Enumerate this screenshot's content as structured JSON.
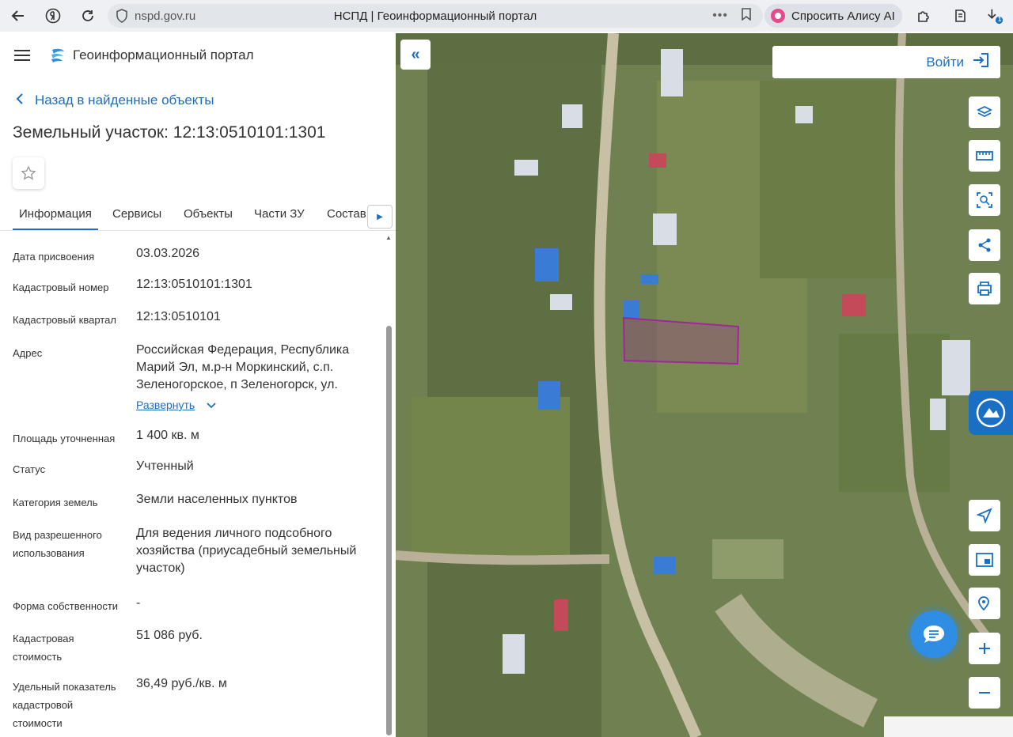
{
  "browser": {
    "url": "nspd.gov.ru",
    "tab_title": "НСПД | Геоинформационный портал",
    "alice_label": "Спросить Алису AI",
    "download_badge": "1"
  },
  "header": {
    "site_name": "Геоинформационный портал"
  },
  "nav": {
    "back_label": "Назад в найденные объекты"
  },
  "object": {
    "title": "Земельный участок: 12:13:0510101:1301"
  },
  "tabs": [
    {
      "label": "Информация",
      "active": true
    },
    {
      "label": "Сервисы"
    },
    {
      "label": "Объекты"
    },
    {
      "label": "Части ЗУ"
    },
    {
      "label": "Состав"
    }
  ],
  "info": [
    {
      "label": "Дата присвоения",
      "value": "03.03.2026"
    },
    {
      "label": "Кадастровый номер",
      "value": "12:13:0510101:1301"
    },
    {
      "label": "Кадастровый квартал",
      "value": "12:13:0510101"
    },
    {
      "label": "Адрес",
      "value": "Российская Федерация, Республика Марий Эл, м.р-н Моркинский, с.п. Зеленогорское, п Зеленогорск, ул.",
      "expand": "Развернуть"
    },
    {
      "label": "Площадь уточненная",
      "value": "1 400 кв. м"
    },
    {
      "label": "Статус",
      "value": "Учтенный"
    },
    {
      "label": "Категория земель",
      "value": "Земли населенных пунктов"
    },
    {
      "label": "Вид разрешенного использования",
      "value": "Для ведения личного подсобного хозяйства (приусадебный земельный участок)"
    },
    {
      "label": "Форма собственности",
      "value": "-"
    },
    {
      "label": "Кадастровая стоимость",
      "value": "51 086 руб."
    },
    {
      "label": "Удельный показатель кадастровой стоимости",
      "value": "36,49 руб./кв. м"
    }
  ],
  "map": {
    "login_label": "Войти",
    "highlight_color": "#a0269a"
  },
  "icons": [
    "back-icon",
    "yandex-icon",
    "reload-icon",
    "shield-icon",
    "bookmark-icon",
    "extensions-icon",
    "collections-icon",
    "download-icon",
    "menu-icon",
    "logo-icon",
    "star-icon",
    "layers-icon",
    "ruler-icon",
    "select-area-icon",
    "share-icon",
    "print-icon",
    "locate-icon",
    "minimap-icon",
    "search-location-icon",
    "zoom-in-icon",
    "zoom-out-icon",
    "chat-icon"
  ]
}
